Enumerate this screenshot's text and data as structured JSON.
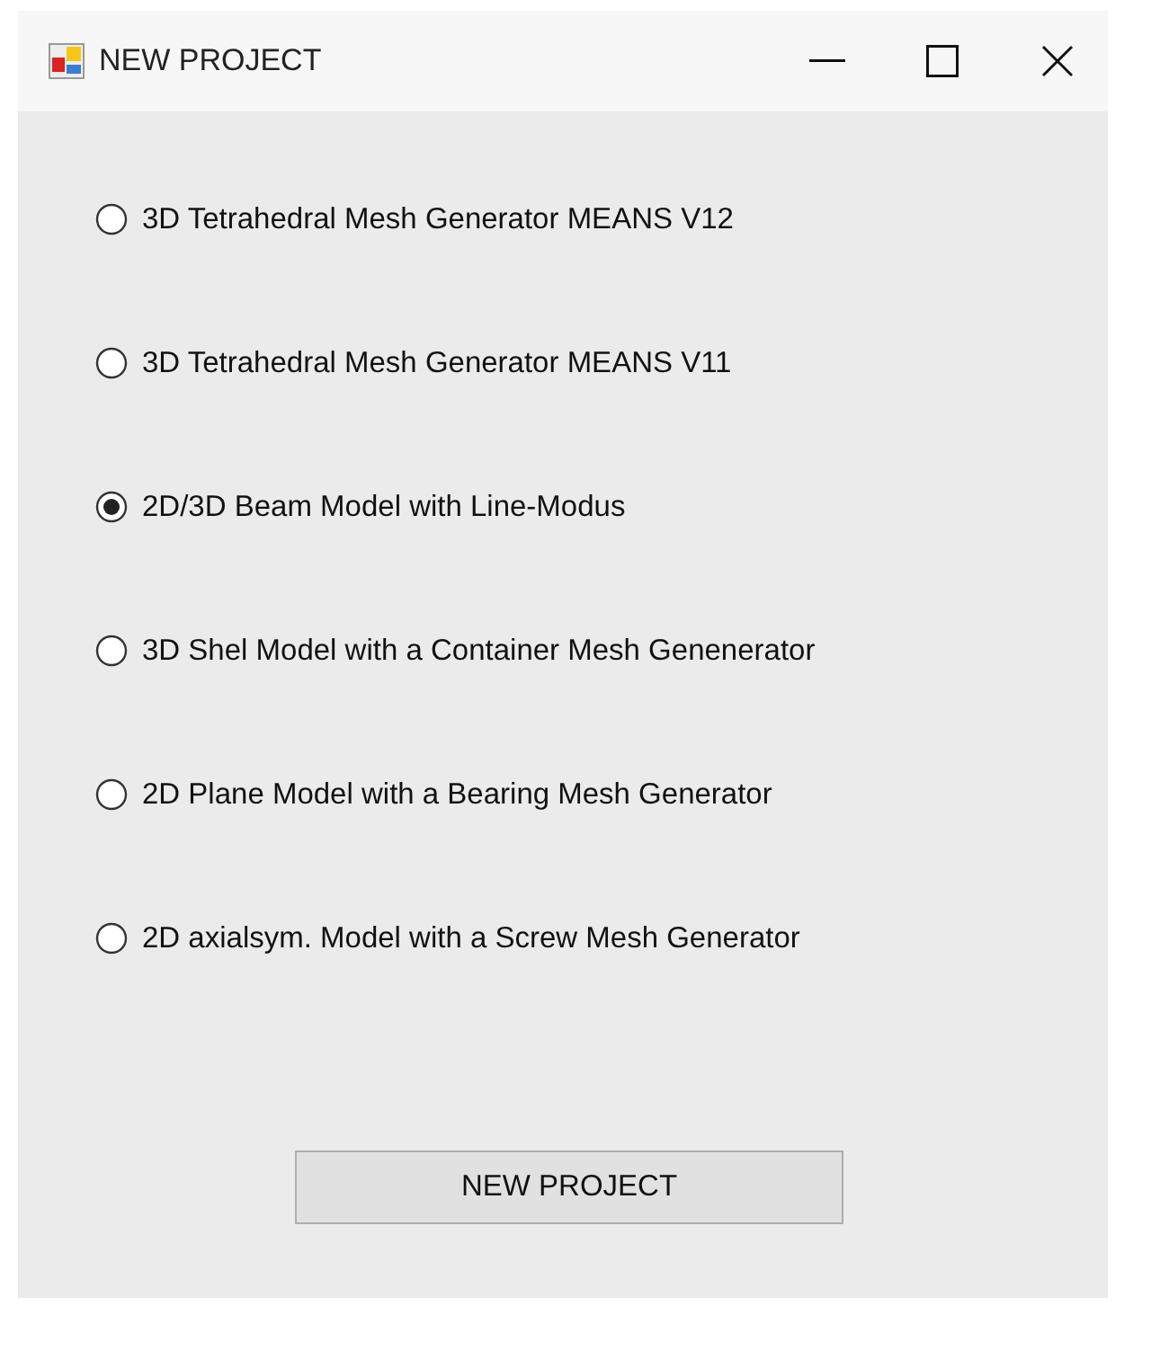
{
  "window": {
    "title": "NEW PROJECT"
  },
  "options": [
    {
      "label": "3D Tetrahedral Mesh Generator MEANS V12",
      "selected": false
    },
    {
      "label": "3D Tetrahedral Mesh Generator MEANS V11",
      "selected": false
    },
    {
      "label": "2D/3D Beam Model with Line-Modus",
      "selected": true
    },
    {
      "label": "3D Shel Model with a Container Mesh Genenerator",
      "selected": false
    },
    {
      "label": "2D Plane Model with a Bearing Mesh Generator",
      "selected": false
    },
    {
      "label": "2D axialsym. Model with a Screw Mesh Generator",
      "selected": false
    }
  ],
  "button": {
    "label": "NEW PROJECT"
  }
}
